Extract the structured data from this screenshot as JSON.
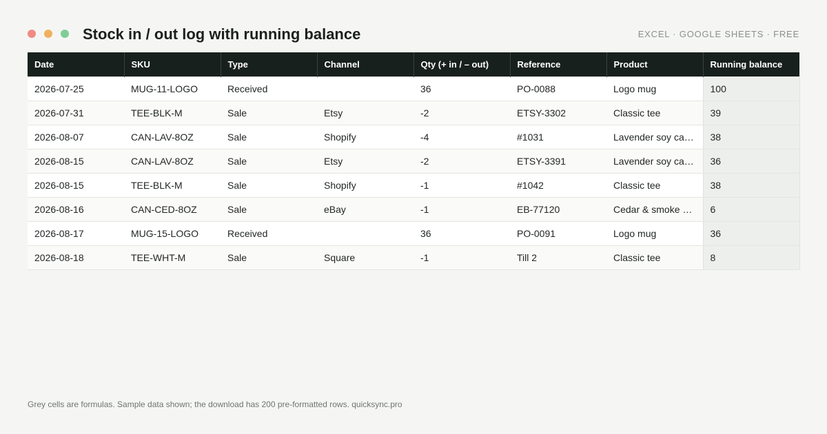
{
  "window": {
    "dot_colors": [
      "#ee8b84",
      "#f0b15f",
      "#7fcd97"
    ]
  },
  "header": {
    "title": "Stock in / out log with running balance",
    "tagline": "EXCEL · GOOGLE SHEETS · FREE"
  },
  "table": {
    "columns": [
      "Date",
      "SKU",
      "Type",
      "Channel",
      "Qty (+ in / – out)",
      "Reference",
      "Product",
      "Running balance"
    ],
    "rows": [
      [
        "2026-07-25",
        "MUG-11-LOGO",
        "Received",
        "",
        "36",
        "PO-0088",
        "Logo mug",
        "100"
      ],
      [
        "2026-07-31",
        "TEE-BLK-M",
        "Sale",
        "Etsy",
        "-2",
        "ETSY-3302",
        "Classic tee",
        "39"
      ],
      [
        "2026-08-07",
        "CAN-LAV-8OZ",
        "Sale",
        "Shopify",
        "-4",
        "#1031",
        "Lavender soy ca…",
        "38"
      ],
      [
        "2026-08-15",
        "CAN-LAV-8OZ",
        "Sale",
        "Etsy",
        "-2",
        "ETSY-3391",
        "Lavender soy ca…",
        "36"
      ],
      [
        "2026-08-15",
        "TEE-BLK-M",
        "Sale",
        "Shopify",
        "-1",
        "#1042",
        "Classic tee",
        "38"
      ],
      [
        "2026-08-16",
        "CAN-CED-8OZ",
        "Sale",
        "eBay",
        "-1",
        "EB-77120",
        "Cedar & smoke …",
        "6"
      ],
      [
        "2026-08-17",
        "MUG-15-LOGO",
        "Received",
        "",
        "36",
        "PO-0091",
        "Logo mug",
        "36"
      ],
      [
        "2026-08-18",
        "TEE-WHT-M",
        "Sale",
        "Square",
        "-1",
        "Till 2",
        "Classic tee",
        "8"
      ]
    ]
  },
  "footer": {
    "note": "Grey cells are formulas. Sample data shown; the download has 200 pre-formatted rows. quicksync.pro"
  }
}
